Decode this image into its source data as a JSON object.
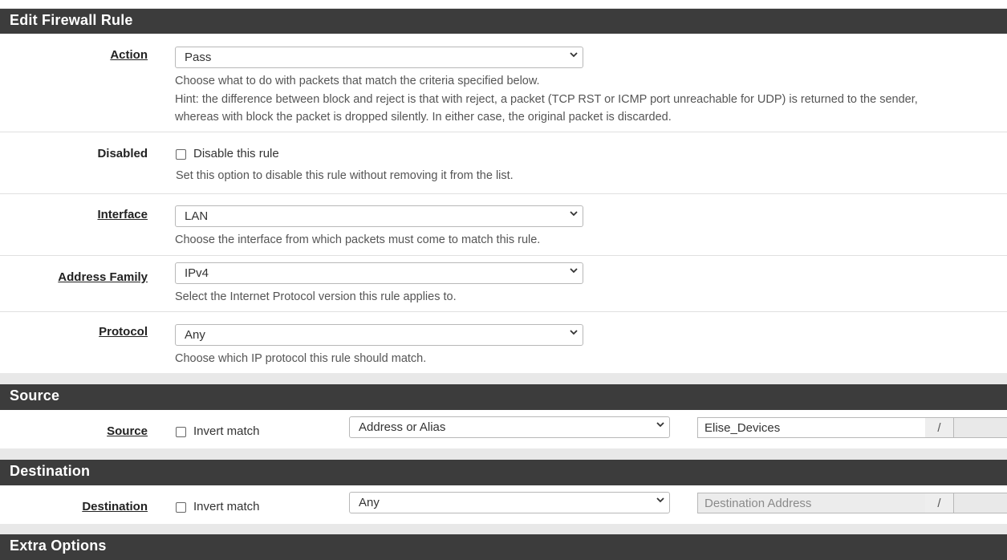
{
  "sections": {
    "edit_title": "Edit Firewall Rule",
    "source_title": "Source",
    "destination_title": "Destination",
    "extra_title": "Extra Options"
  },
  "action": {
    "label": "Action",
    "value": "Pass",
    "help1": "Choose what to do with packets that match the criteria specified below.",
    "help2": "Hint: the difference between block and reject is that with reject, a packet (TCP RST or ICMP port unreachable for UDP) is returned to the sender,",
    "help3": "whereas with block the packet is dropped silently. In either case, the original packet is discarded."
  },
  "disabled": {
    "label": "Disabled",
    "checkbox_label": "Disable this rule",
    "checked": false,
    "help": "Set this option to disable this rule without removing it from the list."
  },
  "interface": {
    "label": "Interface",
    "value": "LAN",
    "help": "Choose the interface from which packets must come to match this rule."
  },
  "address_family": {
    "label": "Address Family",
    "value": "IPv4",
    "help": "Select the Internet Protocol version this rule applies to."
  },
  "protocol": {
    "label": "Protocol",
    "value": "Any",
    "help": "Choose which IP protocol this rule should match."
  },
  "source": {
    "label": "Source",
    "invert_label": "Invert match",
    "invert_checked": false,
    "type_value": "Address or Alias",
    "address_value": "Elise_Devices",
    "slash": "/"
  },
  "destination": {
    "label": "Destination",
    "invert_label": "Invert match",
    "invert_checked": false,
    "type_value": "Any",
    "address_placeholder": "Destination Address",
    "slash": "/"
  },
  "icons": {
    "select": "chevron-down-icon"
  },
  "colors": {
    "panel_heading": "#3c3c3c",
    "page_bg": "#e8e8e8"
  }
}
